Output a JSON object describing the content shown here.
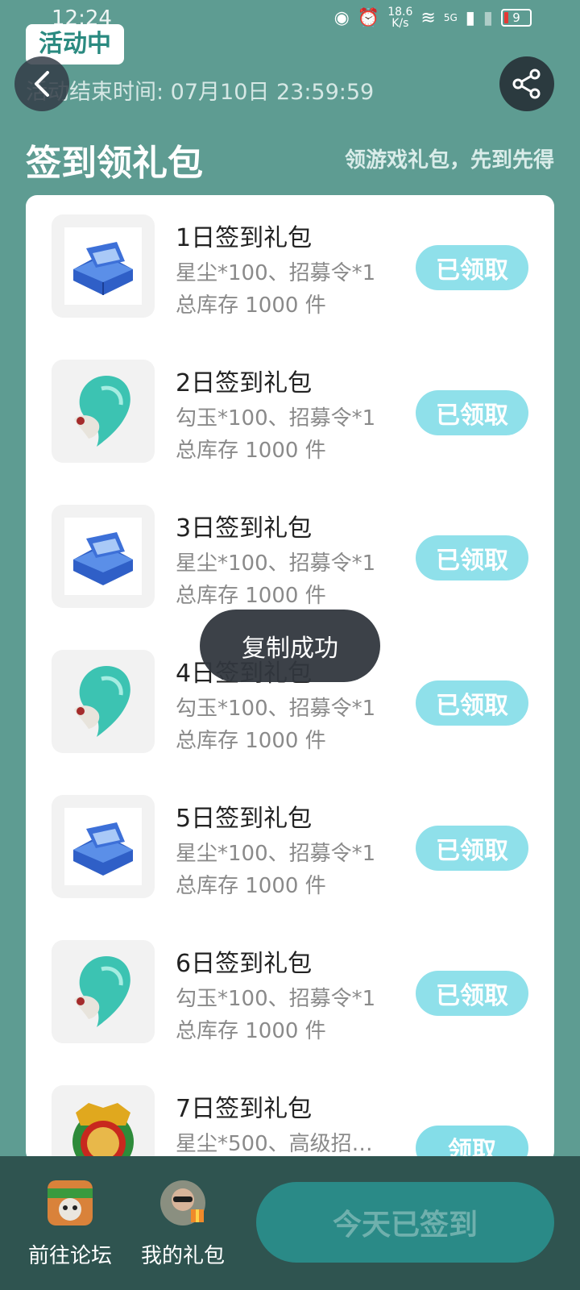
{
  "status_bar": {
    "time": "12:24",
    "net_speed_top": "18.6",
    "net_speed_bottom": "K/s",
    "network": "5G",
    "battery": "9"
  },
  "header": {
    "badge": "活动中",
    "end_time": "活动结束时间: 07月10日 23:59:59",
    "title": "签到领礼包",
    "subtitle": "领游戏礼包，先到先得"
  },
  "gifts": [
    {
      "title": "1日签到礼包",
      "contents": "星尘*100、招募令*1",
      "stock": "总库存 1000 件",
      "button": "已领取",
      "icon": "crystal-chest-icon"
    },
    {
      "title": "2日签到礼包",
      "contents": "勾玉*100、招募令*1",
      "stock": "总库存 1000 件",
      "button": "已领取",
      "icon": "magatama-icon"
    },
    {
      "title": "3日签到礼包",
      "contents": "星尘*100、招募令*1",
      "stock": "总库存 1000 件",
      "button": "已领取",
      "icon": "crystal-chest-icon"
    },
    {
      "title": "4日签到礼包",
      "contents": "勾玉*100、招募令*1",
      "stock": "总库存 1000 件",
      "button": "已领取",
      "icon": "magatama-icon"
    },
    {
      "title": "5日签到礼包",
      "contents": "星尘*100、招募令*1",
      "stock": "总库存 1000 件",
      "button": "已领取",
      "icon": "crystal-chest-icon"
    },
    {
      "title": "6日签到礼包",
      "contents": "勾玉*100、招募令*1",
      "stock": "总库存 1000 件",
      "button": "已领取",
      "icon": "magatama-icon"
    },
    {
      "title": "7日签到礼包",
      "contents": "星尘*500、高级招…",
      "stock": "",
      "button": "领取",
      "icon": "recruit-emblem-icon"
    }
  ],
  "toast": "复制成功",
  "bottom_bar": {
    "forum_label": "前往论坛",
    "my_gifts_label": "我的礼包",
    "sign_button": "今天已签到"
  }
}
